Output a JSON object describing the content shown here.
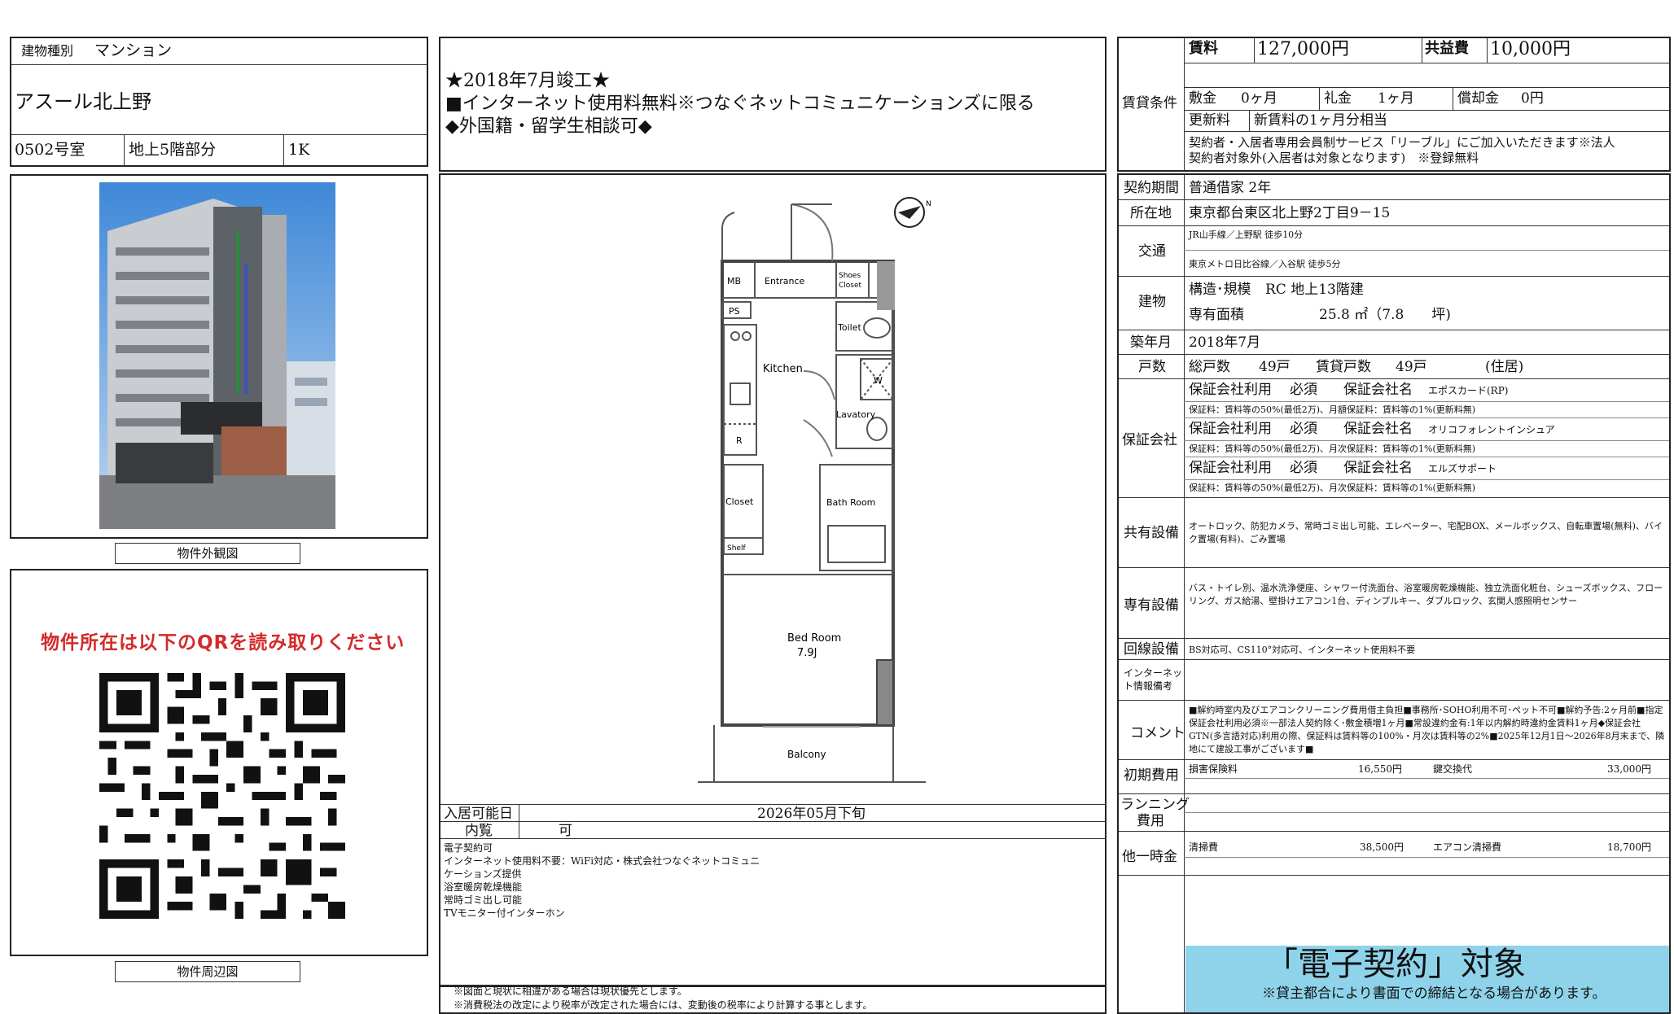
{
  "header": {
    "building_type_label": "建物種別",
    "building_type": "マンション",
    "building_name": "アスール北上野",
    "room": "0502号室",
    "floor": "地上5階部分",
    "layout": "1K"
  },
  "highlights": [
    "★2018年7月竣工★",
    "■インターネット使用料無料※つなぐネットコミュニケーションズに限る",
    "◆外国籍・留学生相談可◆"
  ],
  "photo": {
    "caption": "物件外観図"
  },
  "map": {
    "qr_title": "物件所在は以下のQRを読み取りください",
    "caption": "物件周辺図"
  },
  "floorplan": {
    "labels": {
      "mb": "MB",
      "entrance": "Entrance",
      "shoes_closet_1": "Shoes",
      "shoes_closet_2": "Closet",
      "ps": "PS",
      "toilet": "Toilet",
      "kitchen": "Kitchen",
      "w": "W",
      "lavatory": "Lavatory",
      "r": "R",
      "closet": "Closet",
      "bath_room": "Bath Room",
      "shelf": "Shelf",
      "bed_room": "Bed Room",
      "bed_room_size": "7.9J",
      "balcony": "Balcony",
      "north": "N"
    }
  },
  "availability": {
    "move_in_label": "入居可能日",
    "move_in_value": "2026年05月下旬",
    "viewing_label": "内覧",
    "viewing_value": "可"
  },
  "notes": [
    "電子契約可",
    "インターネット使用料不要：WiFi対応・株式会社つなぐネットコミュニ",
    "ケーションズ提供",
    "浴室暖房乾燥機能",
    "常時ゴミ出し可能",
    "TVモニター付インターホン"
  ],
  "disclaimers": [
    "※図面と現状に相違がある場合は現状優先とします。",
    "※消費税法の改定により税率が改定された場合には、変動後の税率により計算する事とします。"
  ],
  "rental": {
    "section_label": "賃貸条件",
    "rent_label": "賃料",
    "rent_value": "127,000円",
    "common_fee_label": "共益費",
    "common_fee_value": "10,000円",
    "deposit_label": "敷金",
    "deposit_value": "0ヶ月",
    "key_money_label": "礼金",
    "key_money_value": "1ヶ月",
    "amortization_label": "償却金",
    "amortization_value": "0円",
    "renewal_label": "更新料",
    "renewal_value": "新賃料の1ヶ月分相当",
    "membership_line1": "契約者・入居者専用会員制サービス「リーブル」にご加入いただきます※法人",
    "membership_line2": "契約者対象外(入居者は対象となります)　※登録無料"
  },
  "details": {
    "contract_period_label": "契約期間",
    "contract_period_value": "普通借家 2年",
    "address_label": "所在地",
    "address_value": "東京都台東区北上野2丁目9－15",
    "transport_label": "交通",
    "transport_line1": "JR山手線／上野駅 徒歩10分",
    "transport_line2": "東京メトロ日比谷線／入谷駅 徒歩5分",
    "building_label": "建物",
    "structure_label": "構造･規模",
    "structure_value": "RC 地上13階建",
    "area_label": "専有面積",
    "area_value": "25.8 ㎡（7.8　　坪)",
    "built_label": "築年月",
    "built_value": "2018年7月",
    "units_label": "戸数",
    "total_units_label": "総戸数",
    "total_units_value": "49戸",
    "rental_units_label": "賃貸戸数",
    "rental_units_value": "49戸",
    "units_note": "(住居)",
    "guarantee_label": "保証会社",
    "guarantees": [
      {
        "use_label": "保証会社利用",
        "use_value": "必須",
        "name_label": "保証会社名",
        "name_value": "エポスカード(RP)",
        "fee": "保証料：賃料等の50%(最低2万)、月額保証料：賃料等の1%(更新料無)"
      },
      {
        "use_label": "保証会社利用",
        "use_value": "必須",
        "name_label": "保証会社名",
        "name_value": "オリコフォレントインシュア",
        "fee": "保証料：賃料等の50%(最低2万)、月次保証料：賃料等の1%(更新料無)"
      },
      {
        "use_label": "保証会社利用",
        "use_value": "必須",
        "name_label": "保証会社名",
        "name_value": "エルズサポート",
        "fee": "保証料：賃料等の50%(最低2万)、月次保証料：賃料等の1%(更新料無)"
      }
    ],
    "shared_label": "共有設備",
    "shared_value": "オートロック、防犯カメラ、常時ゴミ出し可能、エレベーター、宅配BOX、メールボックス、自転車置場(無料)、バイク置場(有料)、ごみ置場",
    "private_label": "専有設備",
    "private_value": "バス・トイレ別、温水洗浄便座、シャワー付洗面台、浴室暖房乾燥機能、独立洗面化粧台、シューズボックス、フローリング、ガス給湯、壁掛けエアコン1台、ディンプルキー、ダブルロック、玄関人感照明センサー",
    "line_label": "回線設備",
    "line_value": "BS対応可、CS110°対応可、インターネット使用料不要",
    "internet_label_1": "インターネッ",
    "internet_label_2": "ト情報備考",
    "comment_label": "コメント",
    "comment_value": "■解約時室内及びエアコンクリーニング費用借主負担■事務所･SOHO利用不可･ペット不可■解約予告:2ヶ月前■指定保証会社利用必須※一部法人契約除く･敷金積増1ヶ月■常設違約金有:1年以内解約時違約金賃料1ヶ月◆保証会社GTN(多言語対応)利用の際、保証料は賃料等の100%・月次は賃料等の2%■2025年12月1日～2026年8月末まで、隣地にて建設工事がございます■",
    "initial_label": "初期費用",
    "insurance_label": "損害保険料",
    "insurance_value": "16,550円",
    "key_exchange_label": "鍵交換代",
    "key_exchange_value": "33,000円",
    "running_label_1": "ランニング",
    "running_label_2": "費用",
    "other_label": "他一時金",
    "cleaning_label": "清掃費",
    "cleaning_value": "38,500円",
    "ac_cleaning_label": "エアコン清掃費",
    "ac_cleaning_value": "18,700円"
  },
  "econtract": {
    "title": "「電子契約」対象",
    "note": "※貸主都合により書面での締結となる場合があります。",
    "bg_color": "#8fd3ea"
  }
}
